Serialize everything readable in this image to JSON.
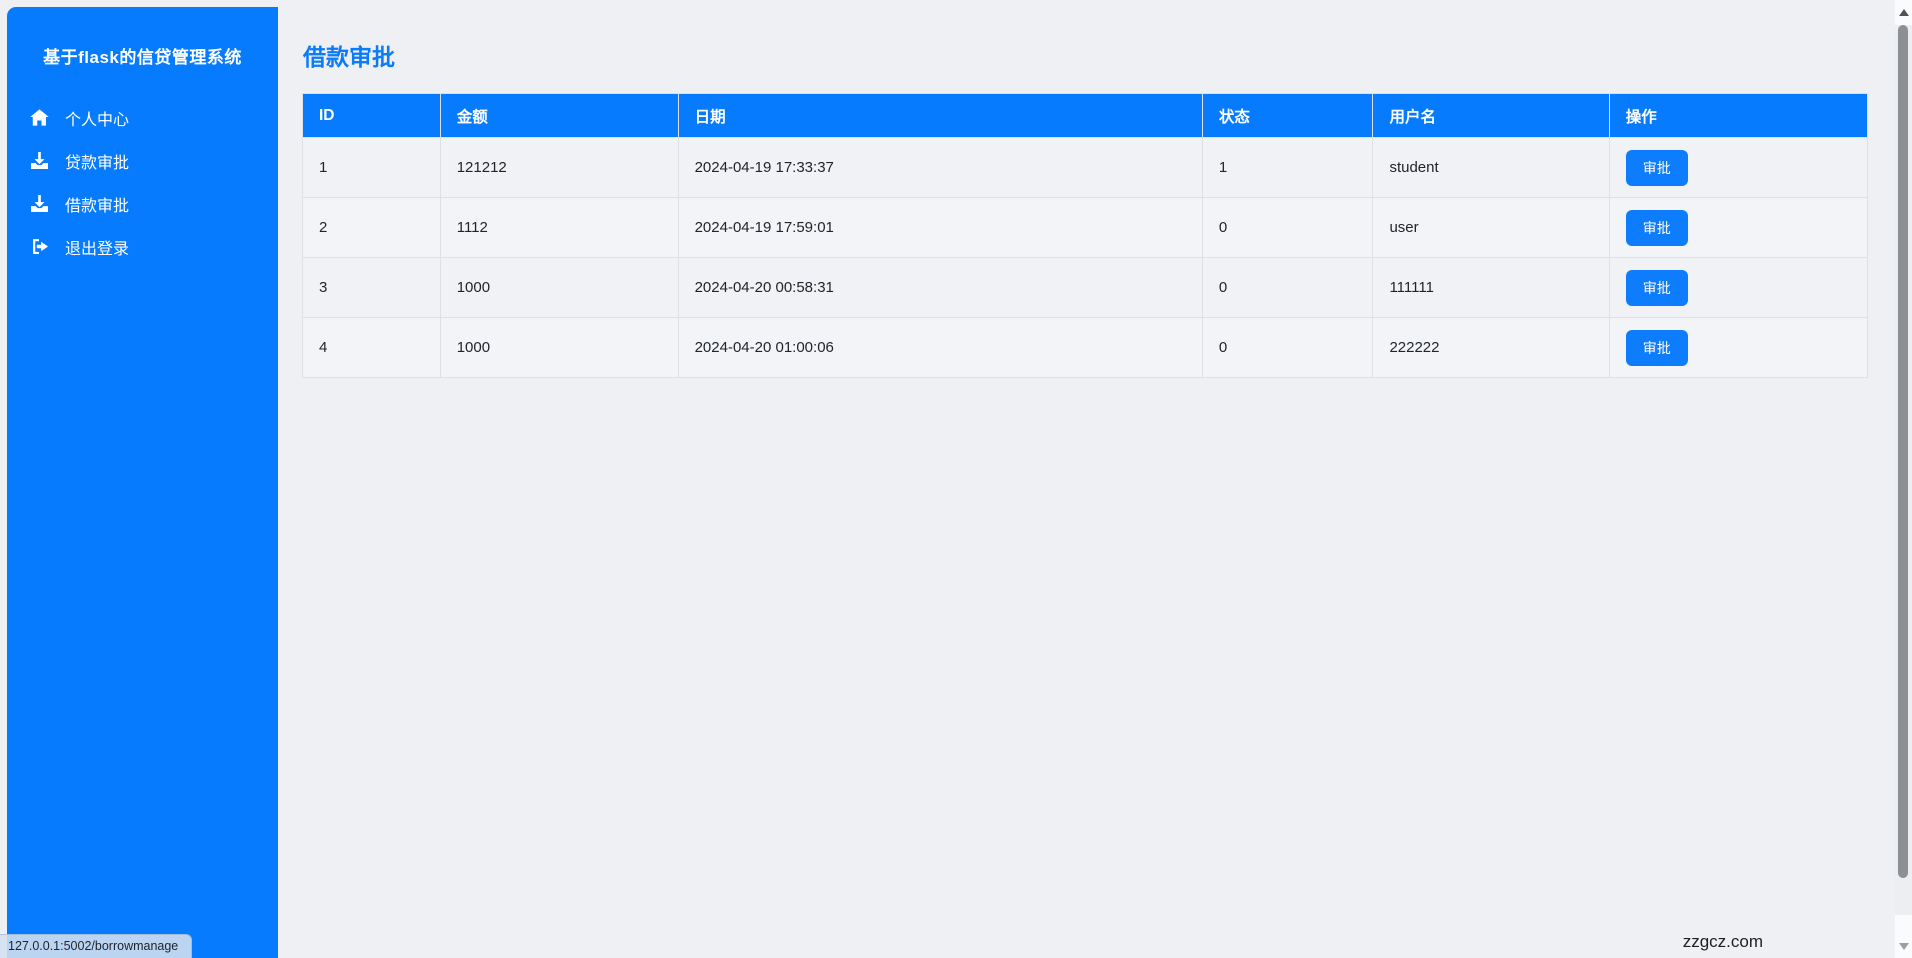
{
  "app": {
    "brand": "基于flask的信贷管理系统"
  },
  "sidebar": {
    "items": [
      {
        "icon": "home-icon",
        "label": "个人中心"
      },
      {
        "icon": "download-icon",
        "label": "贷款审批"
      },
      {
        "icon": "download-icon",
        "label": "借款审批"
      },
      {
        "icon": "sign-out-icon",
        "label": "退出登录"
      }
    ]
  },
  "main": {
    "title": "借款审批",
    "table": {
      "headers": [
        "ID",
        "金额",
        "日期",
        "状态",
        "用户名",
        "操作"
      ],
      "action_label": "审批",
      "rows": [
        {
          "id": "1",
          "amount": "121212",
          "date": "2024-04-19 17:33:37",
          "status": "1",
          "username": "student"
        },
        {
          "id": "2",
          "amount": "1112",
          "date": "2024-04-19 17:59:01",
          "status": "0",
          "username": "user"
        },
        {
          "id": "3",
          "amount": "1000",
          "date": "2024-04-20 00:58:31",
          "status": "0",
          "username": "111111"
        },
        {
          "id": "4",
          "amount": "1000",
          "date": "2024-04-20 01:00:06",
          "status": "0",
          "username": "222222"
        }
      ]
    }
  },
  "statusbar": {
    "url": "127.0.0.1:5002/borrowmanage"
  },
  "watermark": "zzgcz.com",
  "colors": {
    "accent": "#077bfe",
    "page_background": "#eef0f4",
    "button": "#0d7dfd",
    "header_text": "#ffffff",
    "title_text": "#0b7bf8"
  }
}
